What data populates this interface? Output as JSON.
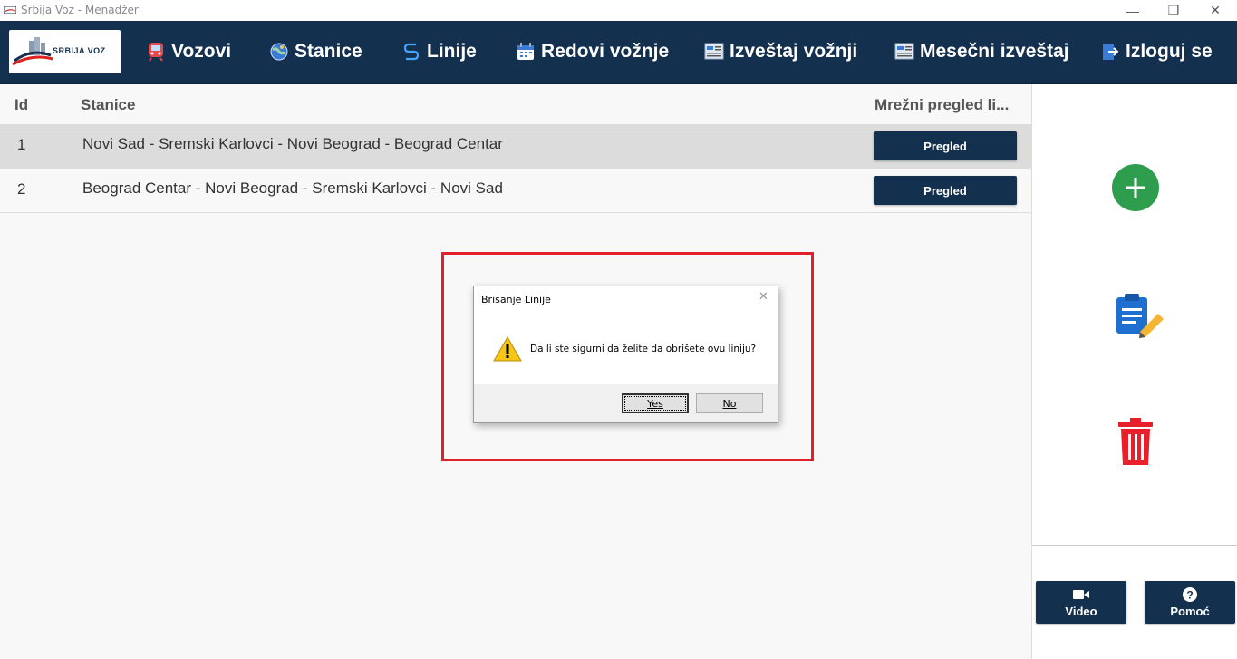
{
  "window": {
    "title": "Srbija Voz - Menadžer",
    "minimize_glyph": "—",
    "restore_glyph": "❐",
    "close_glyph": "✕"
  },
  "nav": {
    "logo_text": "SRBIJA VOZ",
    "items": [
      {
        "label": "Vozovi",
        "icon": "train-icon"
      },
      {
        "label": "Stanice",
        "icon": "globe-icon"
      },
      {
        "label": "Linije",
        "icon": "route-icon"
      },
      {
        "label": "Redovi vožnje",
        "icon": "calendar-icon"
      },
      {
        "label": "Izveštaj vožnji",
        "icon": "report-icon"
      },
      {
        "label": "Mesečni izveštaj",
        "icon": "report-icon"
      },
      {
        "label": "Izloguj se",
        "icon": "logout-icon"
      }
    ]
  },
  "table": {
    "headers": {
      "id": "Id",
      "stanice": "Stanice",
      "pregled": "Mrežni pregled li..."
    },
    "rows": [
      {
        "id": "1",
        "stanice": "Novi Sad - Sremski Karlovci - Novi Beograd - Beograd Centar",
        "button": "Pregled",
        "selected": true
      },
      {
        "id": "2",
        "stanice": "Beograd Centar - Novi Beograd - Sremski Karlovci - Novi Sad",
        "button": "Pregled",
        "selected": false
      }
    ]
  },
  "side": {
    "video_label": "Video",
    "pomoc_label": "Pomoć"
  },
  "dialog": {
    "title": "Brisanje Linije",
    "close_glyph": "✕",
    "message": "Da li ste sigurni da želite da obrišete ovu liniju?",
    "yes_label": "Yes",
    "no_label": "No"
  },
  "colors": {
    "nav_bg": "#14304f",
    "add_green": "#2e9e4e",
    "delete_red": "#e8202a",
    "edit_blue": "#1f6fd0",
    "highlight_red": "#e0212c"
  }
}
